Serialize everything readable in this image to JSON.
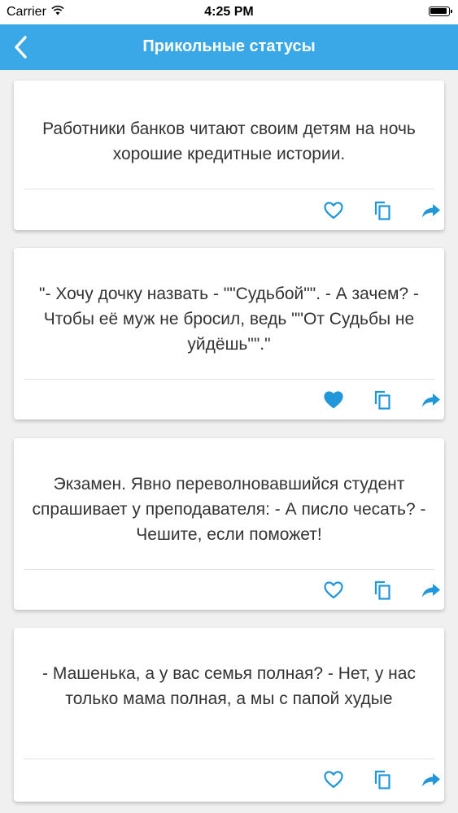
{
  "status_bar": {
    "carrier": "Carrier",
    "time": "4:25 PM"
  },
  "nav": {
    "title": "Прикольные статусы",
    "back_icon": "chevron-left-icon"
  },
  "colors": {
    "accent": "#3aa7e6",
    "background": "#f0f0f0",
    "card": "#ffffff",
    "text": "#333333"
  },
  "cards": [
    {
      "text": "Работники банков читают своим детям на ночь хорошие кредитные истории.",
      "liked": false
    },
    {
      "text": "\"- Хочу дочку назвать - \"\"Судьбой\"\". - А зачем? - Чтобы её муж не бросил, ведь \"\"От Судьбы не уйдёшь\"\".\"",
      "liked": true
    },
    {
      "text": "Экзамен. Явно переволновавшийся студент спрашивает у преподавателя: - А писло чесать? - Чешите, если поможет!",
      "liked": false
    },
    {
      "text": "- Машенька, а у вас семья полная? - Нет, у нас только мама полная, а мы с папой худые",
      "liked": false
    }
  ]
}
